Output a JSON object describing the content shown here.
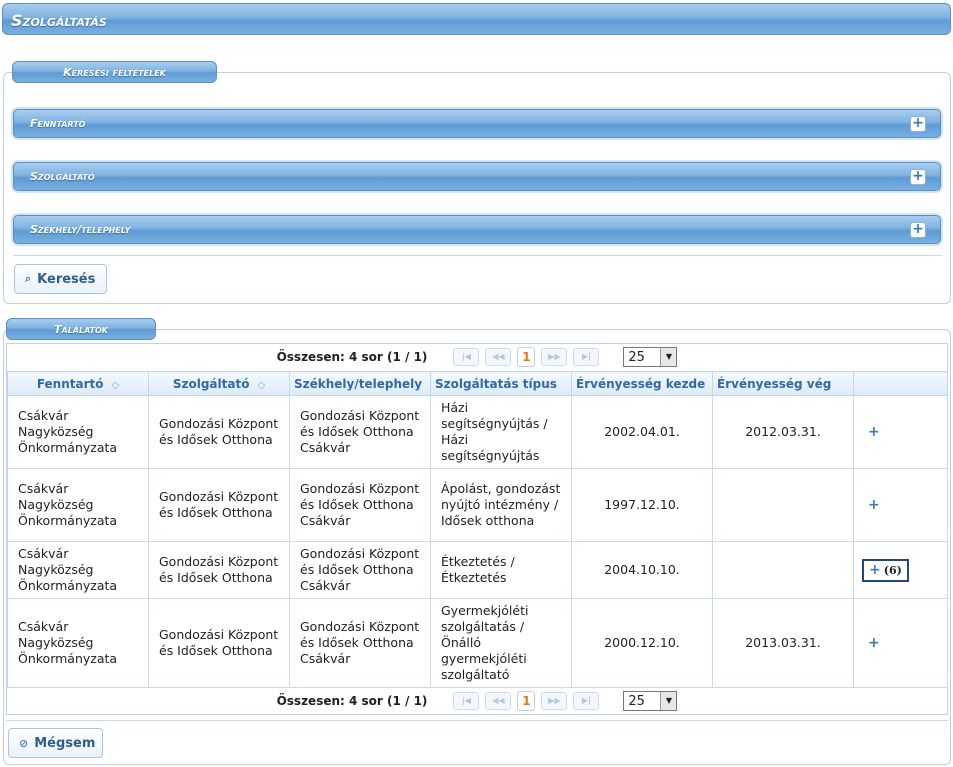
{
  "title": "Szolgáltatás",
  "search": {
    "legend": "Keresési feltételek",
    "sections": [
      "Fenntartó",
      "Szolgáltató",
      "Székhely/telephely"
    ],
    "search_button": "Keresés"
  },
  "results": {
    "legend": "Találatok",
    "pager": {
      "total": "Összesen: 4 sor (1 / 1)",
      "current_page": "1",
      "page_size": "25"
    },
    "columns": [
      "Fenntartó",
      "Szolgáltató",
      "Székhely/telephely",
      "Szolgáltatás típus",
      "Érvényesség kezde",
      "Érvényesség vég"
    ],
    "rows": [
      {
        "fenntarto": "Csákvár Nagyközség Önkormányzata",
        "szolgaltato": "Gondozási Központ és Idősek Otthona",
        "szekhely": "Gondozási Központ és Idősek Otthona Csákvár",
        "tipus": "Házi segítségnyújtás / Házi segítségnyújtás",
        "kezdet": "2002.04.01.",
        "veg": "2012.03.31.",
        "action": "+"
      },
      {
        "fenntarto": "Csákvár Nagyközség Önkormányzata",
        "szolgaltato": "Gondozási Központ és Idősek Otthona",
        "szekhely": "Gondozási Központ és Idősek Otthona Csákvár",
        "tipus": "Ápolást, gondozást nyújtó intézmény / Idősek otthona",
        "kezdet": "1997.12.10.",
        "veg": "",
        "action": "+"
      },
      {
        "fenntarto": "Csákvár Nagyközség Önkormányzata",
        "szolgaltato": "Gondozási Központ és Idősek Otthona",
        "szekhely": "Gondozási Központ és Idősek Otthona Csákvár",
        "tipus": "Étkeztetés / Étkeztetés",
        "kezdet": "2004.10.10.",
        "veg": "",
        "action": "(6)"
      },
      {
        "fenntarto": "Csákvár Nagyközség Önkormányzata",
        "szolgaltato": "Gondozási Központ és Idősek Otthona",
        "szekhely": "Gondozási Központ és Idősek Otthona Csákvár",
        "tipus": "Gyermekjóléti szolgáltatás / Önálló gyermekjóléti szolgáltató",
        "kezdet": "2000.12.10.",
        "veg": "2013.03.31.",
        "action": "+"
      }
    ]
  },
  "cancel_button": "Mégsem",
  "icons": {
    "search": "magnifier-icon",
    "cancel": "cancel-icon",
    "expand": "plus-icon",
    "sort": "sort-arrows-icon"
  },
  "colors": {
    "header_blue": "#7fb2e0",
    "border": "#b9d0e6",
    "accent_orange": "#e07a1a"
  }
}
